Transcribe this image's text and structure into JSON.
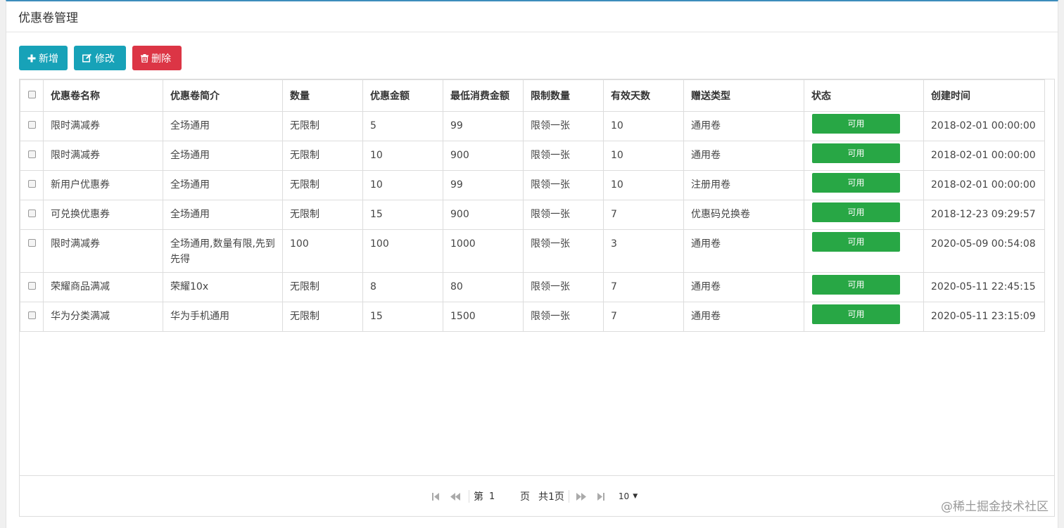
{
  "panel": {
    "title": "优惠卷管理"
  },
  "toolbar": {
    "add_label": "新增",
    "edit_label": "修改",
    "delete_label": "删除"
  },
  "table": {
    "headers": [
      "优惠卷名称",
      "优惠卷简介",
      "数量",
      "优惠金额",
      "最低消费金额",
      "限制数量",
      "有效天数",
      "赠送类型",
      "状态",
      "创建时间"
    ],
    "rows": [
      [
        "限时满减券",
        "全场通用",
        "无限制",
        "5",
        "99",
        "限领一张",
        "10",
        "通用卷",
        "可用",
        "2018-02-01 00:00:00"
      ],
      [
        "限时满减券",
        "全场通用",
        "无限制",
        "10",
        "900",
        "限领一张",
        "10",
        "通用卷",
        "可用",
        "2018-02-01 00:00:00"
      ],
      [
        "新用户优惠券",
        "全场通用",
        "无限制",
        "10",
        "99",
        "限领一张",
        "10",
        "注册用卷",
        "可用",
        "2018-02-01 00:00:00"
      ],
      [
        "可兑换优惠券",
        "全场通用",
        "无限制",
        "15",
        "900",
        "限领一张",
        "7",
        "优惠码兑换卷",
        "可用",
        "2018-12-23 09:29:57"
      ],
      [
        "限时满减券",
        "全场通用,数量有限,先到先得",
        "100",
        "100",
        "1000",
        "限领一张",
        "3",
        "通用卷",
        "可用",
        "2020-05-09 00:54:08"
      ],
      [
        "荣耀商品满减",
        "荣耀10x",
        "无限制",
        "8",
        "80",
        "限领一张",
        "7",
        "通用卷",
        "可用",
        "2020-05-11 22:45:15"
      ],
      [
        "华为分类满减",
        "华为手机通用",
        "无限制",
        "15",
        "1500",
        "限领一张",
        "7",
        "通用卷",
        "可用",
        "2020-05-11 23:15:09"
      ]
    ]
  },
  "pager": {
    "page_prefix": "第",
    "current_page": "1",
    "page_suffix": "页",
    "total_pages": "共1页",
    "page_size": "10"
  },
  "watermark": "@稀土掘金技术社区",
  "colors": {
    "accent": "#17a2b8",
    "danger": "#dc3545",
    "success": "#28a745",
    "border_top": "#3c8dbc"
  }
}
